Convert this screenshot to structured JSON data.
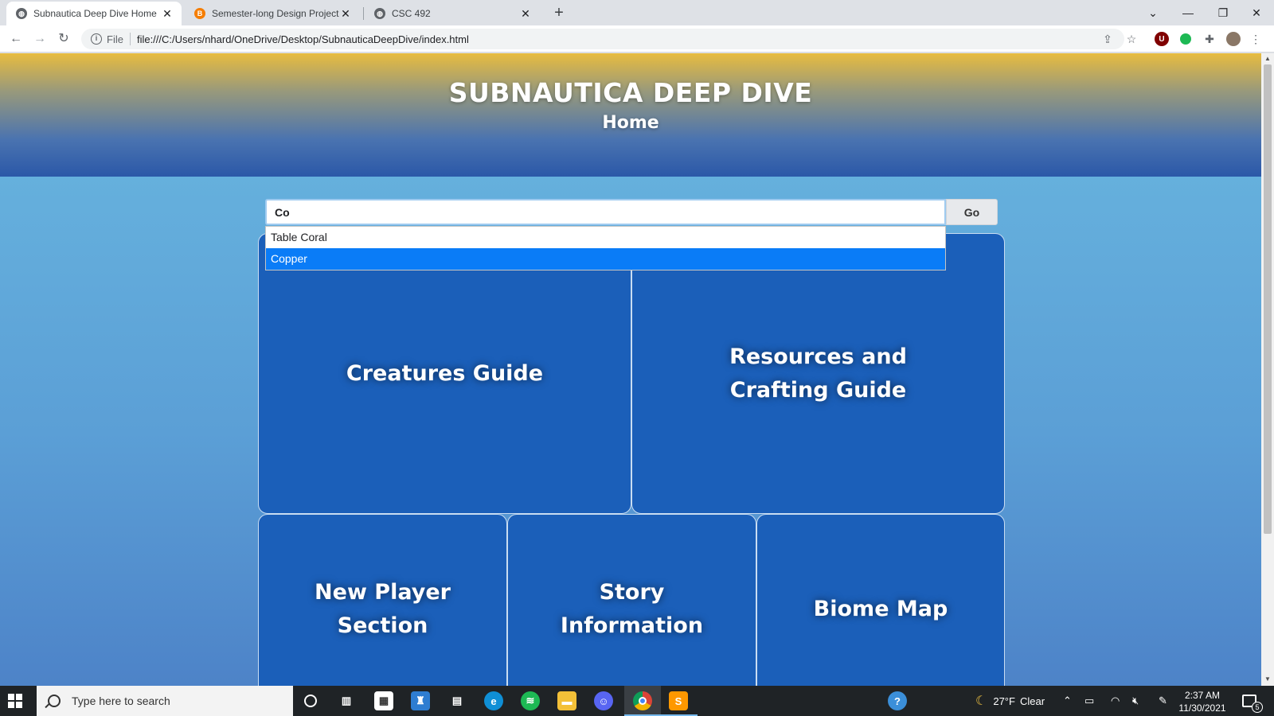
{
  "browser": {
    "tabs": [
      {
        "title": "Subnautica Deep Dive Home",
        "active": true
      },
      {
        "title": "Semester-long Design Project - C",
        "active": false
      },
      {
        "title": "CSC 492",
        "active": false
      }
    ],
    "new_tab_label": "+",
    "address": {
      "scheme_label": "File",
      "url": "file:///C:/Users/nhard/OneDrive/Desktop/SubnauticaDeepDive/index.html"
    },
    "extension_badge": "U",
    "tab_favicon_letter": "B"
  },
  "page": {
    "site_title": "SUBNAUTICA DEEP DIVE",
    "page_subtitle": "Home",
    "search": {
      "value": "Co",
      "go_label": "Go",
      "suggestions": [
        "Table Coral",
        "Copper"
      ],
      "selected_index": 1
    },
    "tiles": [
      {
        "label": "Creatures Guide"
      },
      {
        "label": "Resources and Crafting Guide"
      },
      {
        "label": "New Player Section"
      },
      {
        "label": "Story Information"
      },
      {
        "label": "Biome Map"
      }
    ],
    "colors": {
      "tile_bg": "#1b5fb9",
      "hero_top": "#e8bc3f",
      "hero_bottom": "#2b58a8",
      "selected_suggestion": "#0a7cf7"
    }
  },
  "taskbar": {
    "search_placeholder": "Type here to search",
    "weather": {
      "temp": "27°F",
      "condition": "Clear"
    },
    "clock": {
      "time": "2:37 AM",
      "date": "11/30/2021"
    },
    "notification_count": "5",
    "apps": [
      "cortana-icon",
      "task-view-icon",
      "store-icon",
      "app-icon",
      "file-icon",
      "edge-icon",
      "spotify-icon",
      "explorer-icon",
      "discord-icon",
      "chrome-icon",
      "sublime-icon"
    ]
  }
}
